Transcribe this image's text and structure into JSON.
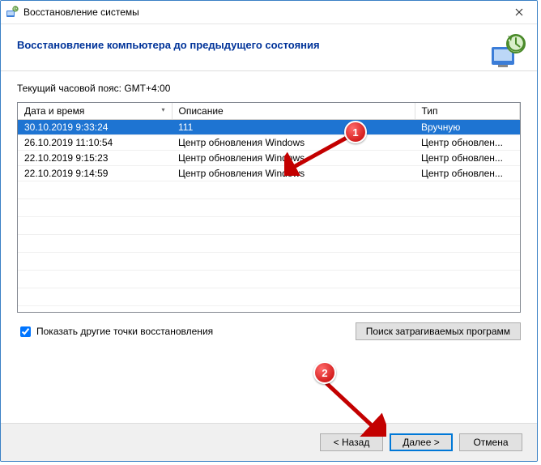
{
  "window": {
    "title": "Восстановление системы"
  },
  "header": {
    "heading": "Восстановление компьютера до предыдущего состояния"
  },
  "body": {
    "tz_label": "Текущий часовой пояс: GMT+4:00",
    "columns": {
      "datetime": "Дата и время",
      "description": "Описание",
      "type": "Тип"
    },
    "rows": [
      {
        "datetime": "30.10.2019 9:33:24",
        "description": "111",
        "type": "Вручную"
      },
      {
        "datetime": "26.10.2019 11:10:54",
        "description": "Центр обновления Windows",
        "type": "Центр обновлен..."
      },
      {
        "datetime": "22.10.2019 9:15:23",
        "description": "Центр обновления Windows",
        "type": "Центр обновлен..."
      },
      {
        "datetime": "22.10.2019 9:14:59",
        "description": "Центр обновления Windows",
        "type": "Центр обновлен..."
      }
    ],
    "show_more_checkbox": "Показать другие точки восстановления",
    "show_more_checked": true,
    "affected_programs_btn": "Поиск затрагиваемых программ"
  },
  "footer": {
    "back": "< Назад",
    "next": "Далее >",
    "cancel": "Отмена"
  },
  "annotations": {
    "badge1": "1",
    "badge2": "2"
  }
}
